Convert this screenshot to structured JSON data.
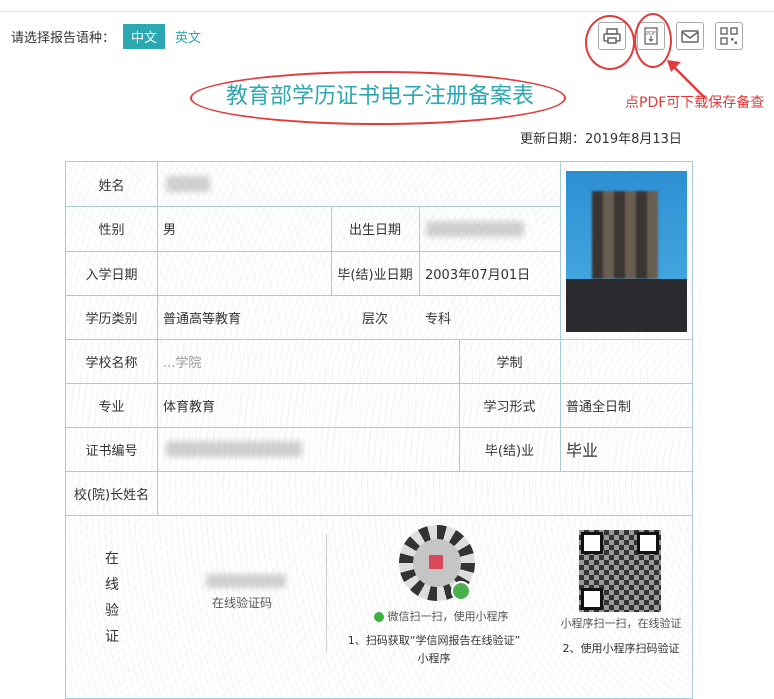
{
  "lang": {
    "label": "请选择报告语种：",
    "zh": "中文",
    "en": "英文"
  },
  "toolbar": {
    "icons": [
      "printer-icon",
      "pdf-icon",
      "mail-icon",
      "qrcode-icon"
    ]
  },
  "annotation": "点PDF可下载保存备查",
  "title": "教育部学历证书电子注册备案表",
  "updated": "更新日期：2019年8月13日",
  "form": {
    "name_label": "姓名",
    "gender_label": "性别",
    "gender": "男",
    "birth_label": "出生日期",
    "enroll_label": "入学日期",
    "grad_label": "毕(结)业日期",
    "grad_date": "2003年07月01日",
    "type_label": "学历类别",
    "type": "普通高等教育",
    "level_label": "层次",
    "level": "专科",
    "school_label": "学校名称",
    "school_partial": "...学院",
    "length_label": "学制",
    "major_label": "专业",
    "major": "体育教育",
    "mode_label": "学习形式",
    "mode": "普通全日制",
    "cert_label": "证书编号",
    "status_label": "毕(结)业",
    "status": "毕业",
    "president_label": "校(院)长姓名",
    "verify_chars": [
      "在",
      "线",
      "验",
      "证"
    ],
    "verify_code_label": "在线验证码",
    "wechat_scan": "微信扫一扫，使用小程序",
    "step1": "1、扫码获取“学信网报告在线验证”",
    "step1b": "小程序",
    "mini_scan": "小程序扫一扫，在线验证",
    "step2": "2、使用小程序扫码验证"
  }
}
